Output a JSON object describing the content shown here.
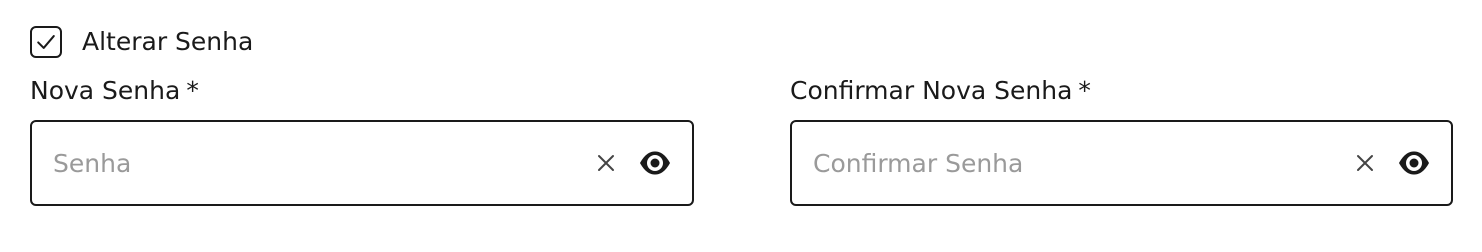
{
  "change_password": {
    "label": "Alterar Senha",
    "checked": true
  },
  "new_password": {
    "label": "Nova Senha",
    "required_mark": "*",
    "value": "",
    "placeholder": "Senha"
  },
  "confirm_password": {
    "label": "Confirmar Nova Senha",
    "required_mark": "*",
    "value": "",
    "placeholder": "Confirmar Senha"
  },
  "icons": {
    "check": "check-icon",
    "clear": "close-icon",
    "reveal": "eye-icon"
  },
  "colors": {
    "text": "#1a1a1a",
    "placeholder": "#9a9a9a",
    "border": "#1a1a1a"
  }
}
